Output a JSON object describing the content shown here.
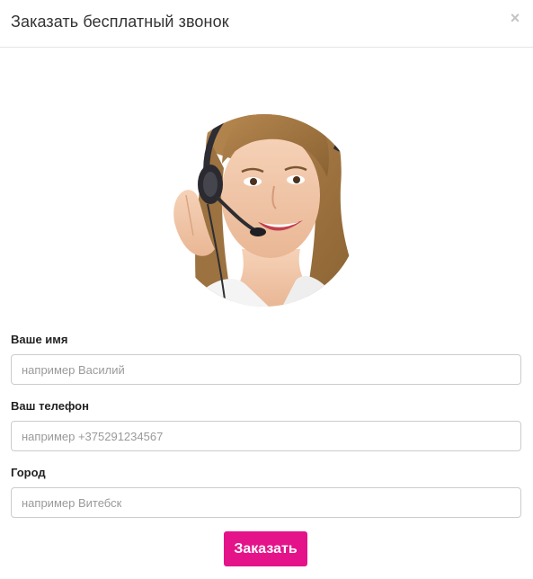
{
  "modal": {
    "title": "Заказать бесплатный звонок",
    "close_glyph": "×"
  },
  "image": {
    "icon": "call-center-operator-photo"
  },
  "form": {
    "name_label": "Ваше имя",
    "name_placeholder": "например Василий",
    "name_value": "",
    "phone_label": "Ваш телефон",
    "phone_placeholder": "например +375291234567",
    "phone_value": "",
    "city_label": "Город",
    "city_placeholder": "например Витебск",
    "city_value": "",
    "submit_label": "Заказать"
  },
  "colors": {
    "accent": "#e5138a",
    "border": "#cccccc",
    "close": "#c4c4c4"
  }
}
